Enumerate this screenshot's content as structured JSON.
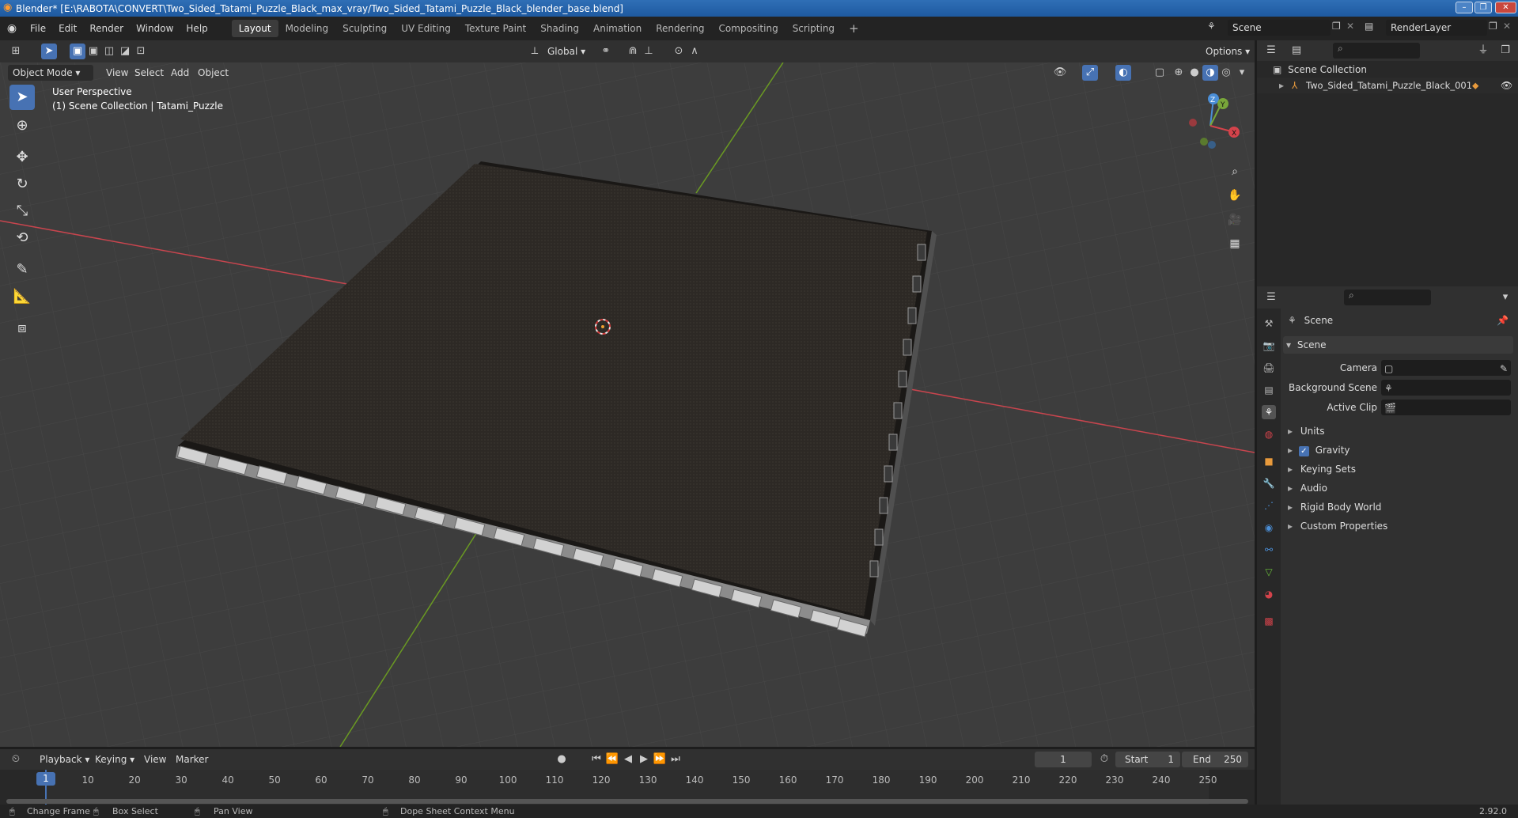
{
  "window": {
    "title": "Blender* [E:\\RABOTA\\CONVERT\\Two_Sided_Tatami_Puzzle_Black_max_vray/Two_Sided_Tatami_Puzzle_Black_blender_base.blend]"
  },
  "menubar": {
    "menus": [
      "File",
      "Edit",
      "Render",
      "Window",
      "Help"
    ],
    "workspaces": [
      "Layout",
      "Modeling",
      "Sculpting",
      "UV Editing",
      "Texture Paint",
      "Shading",
      "Animation",
      "Rendering",
      "Compositing",
      "Scripting"
    ],
    "active_workspace": "Layout",
    "add_tab": "+",
    "scene_name": "Scene",
    "view_layer": "RenderLayer"
  },
  "viewport_header": {
    "mode": "Object Mode",
    "menus": [
      "View",
      "Select",
      "Add",
      "Object"
    ],
    "transform_orientation": "Global",
    "options_label": "Options"
  },
  "viewport": {
    "overlay_line1": "User Perspective",
    "overlay_line2": "(1) Scene Collection | Tatami_Puzzle",
    "axis_labels": {
      "x": "X",
      "y": "Y",
      "z": "Z"
    },
    "colors": {
      "background": "#3d3d3d",
      "x_axis": "#c8454e",
      "y_axis": "#6a9a22",
      "mat": "#2e2a26"
    }
  },
  "outliner": {
    "root": "Scene Collection",
    "items": [
      {
        "label": "Two_Sided_Tatami_Puzzle_Black_001"
      }
    ]
  },
  "properties": {
    "context_title": "Scene",
    "panel_title": "Scene",
    "fields": [
      {
        "label": "Camera",
        "value": ""
      },
      {
        "label": "Background Scene",
        "value": ""
      },
      {
        "label": "Active Clip",
        "value": ""
      }
    ],
    "sections": [
      "Units",
      "Gravity",
      "Keying Sets",
      "Audio",
      "Rigid Body World",
      "Custom Properties"
    ],
    "gravity_checked": true
  },
  "timeline": {
    "menus": [
      "Playback",
      "Keying",
      "View",
      "Marker"
    ],
    "current_frame": "1",
    "start_label": "Start",
    "start_value": "1",
    "end_label": "End",
    "end_value": "250",
    "ticks": [
      "1",
      "10",
      "20",
      "30",
      "40",
      "50",
      "60",
      "70",
      "80",
      "90",
      "100",
      "110",
      "120",
      "130",
      "140",
      "150",
      "160",
      "170",
      "180",
      "190",
      "200",
      "210",
      "220",
      "230",
      "240",
      "250"
    ]
  },
  "statusbar": {
    "items": [
      "Change Frame",
      "Box Select",
      "Pan View",
      "Dope Sheet Context Menu"
    ],
    "version": "2.92.0"
  }
}
